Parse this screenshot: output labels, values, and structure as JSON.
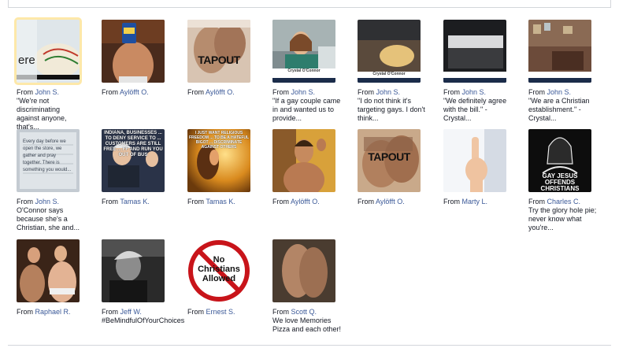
{
  "from_prefix": "From",
  "photos": [
    {
      "author": "John S.",
      "caption": "\"We're not discriminating against anyone, that's...",
      "overlay": "ere"
    },
    {
      "author": "Aylöfft O.",
      "caption": ""
    },
    {
      "author": "Aylöfft O.",
      "caption": "",
      "overlay": "TAPOUT"
    },
    {
      "author": "John S.",
      "caption": "\"If a gay couple came in and wanted us to provide...",
      "overlay": "Crystal O'Connor"
    },
    {
      "author": "John S.",
      "caption": "\"I do not think it's targeting gays. I don't think...",
      "overlay": "Crystal O'Connor"
    },
    {
      "author": "John S.",
      "caption": "\"We definitely agree with the bill.\" - Crystal..."
    },
    {
      "author": "John S.",
      "caption": "\"We are a Christian establishment.\" - Crystal..."
    },
    {
      "author": "John S.",
      "caption": "O'Connor says because she's a Christian, she and...",
      "overlay": "Every day before we open the store, we gather and pray together. There is something you would..."
    },
    {
      "author": "Tamas K.",
      "caption": "",
      "overlay": "INDIANA, BUSINESSES ... TO DENY SERVICE TO ... CUSTOMERS ARE STILL FREE ... FF AND RUN YOU OUT OF BUS"
    },
    {
      "author": "Tamas K.",
      "caption": "",
      "overlay": "I JUST WANT RELIGIOUS FREEDOM ... TO BE A HATEFUL BIGOT ... DISCRIMINATE AGAINST OTHERS"
    },
    {
      "author": "Aylöfft O.",
      "caption": ""
    },
    {
      "author": "Aylöfft O.",
      "caption": "",
      "overlay": "TAPOUT"
    },
    {
      "author": "Marty L.",
      "caption": ""
    },
    {
      "author": "Charles C.",
      "caption": "Try the glory hole pie; never know what you're...",
      "overlay": "GAY JESUS OFFENDS CHRISTIANS"
    },
    {
      "author": "Raphael R.",
      "caption": ""
    },
    {
      "author": "Jeff W.",
      "caption": "#BeMindfulOfYourChoices"
    },
    {
      "author": "Ernest S.",
      "caption": "",
      "overlay": "No Christians Allowed"
    },
    {
      "author": "Scott Q.",
      "caption": "We love Memories Pizza and each other!"
    }
  ]
}
